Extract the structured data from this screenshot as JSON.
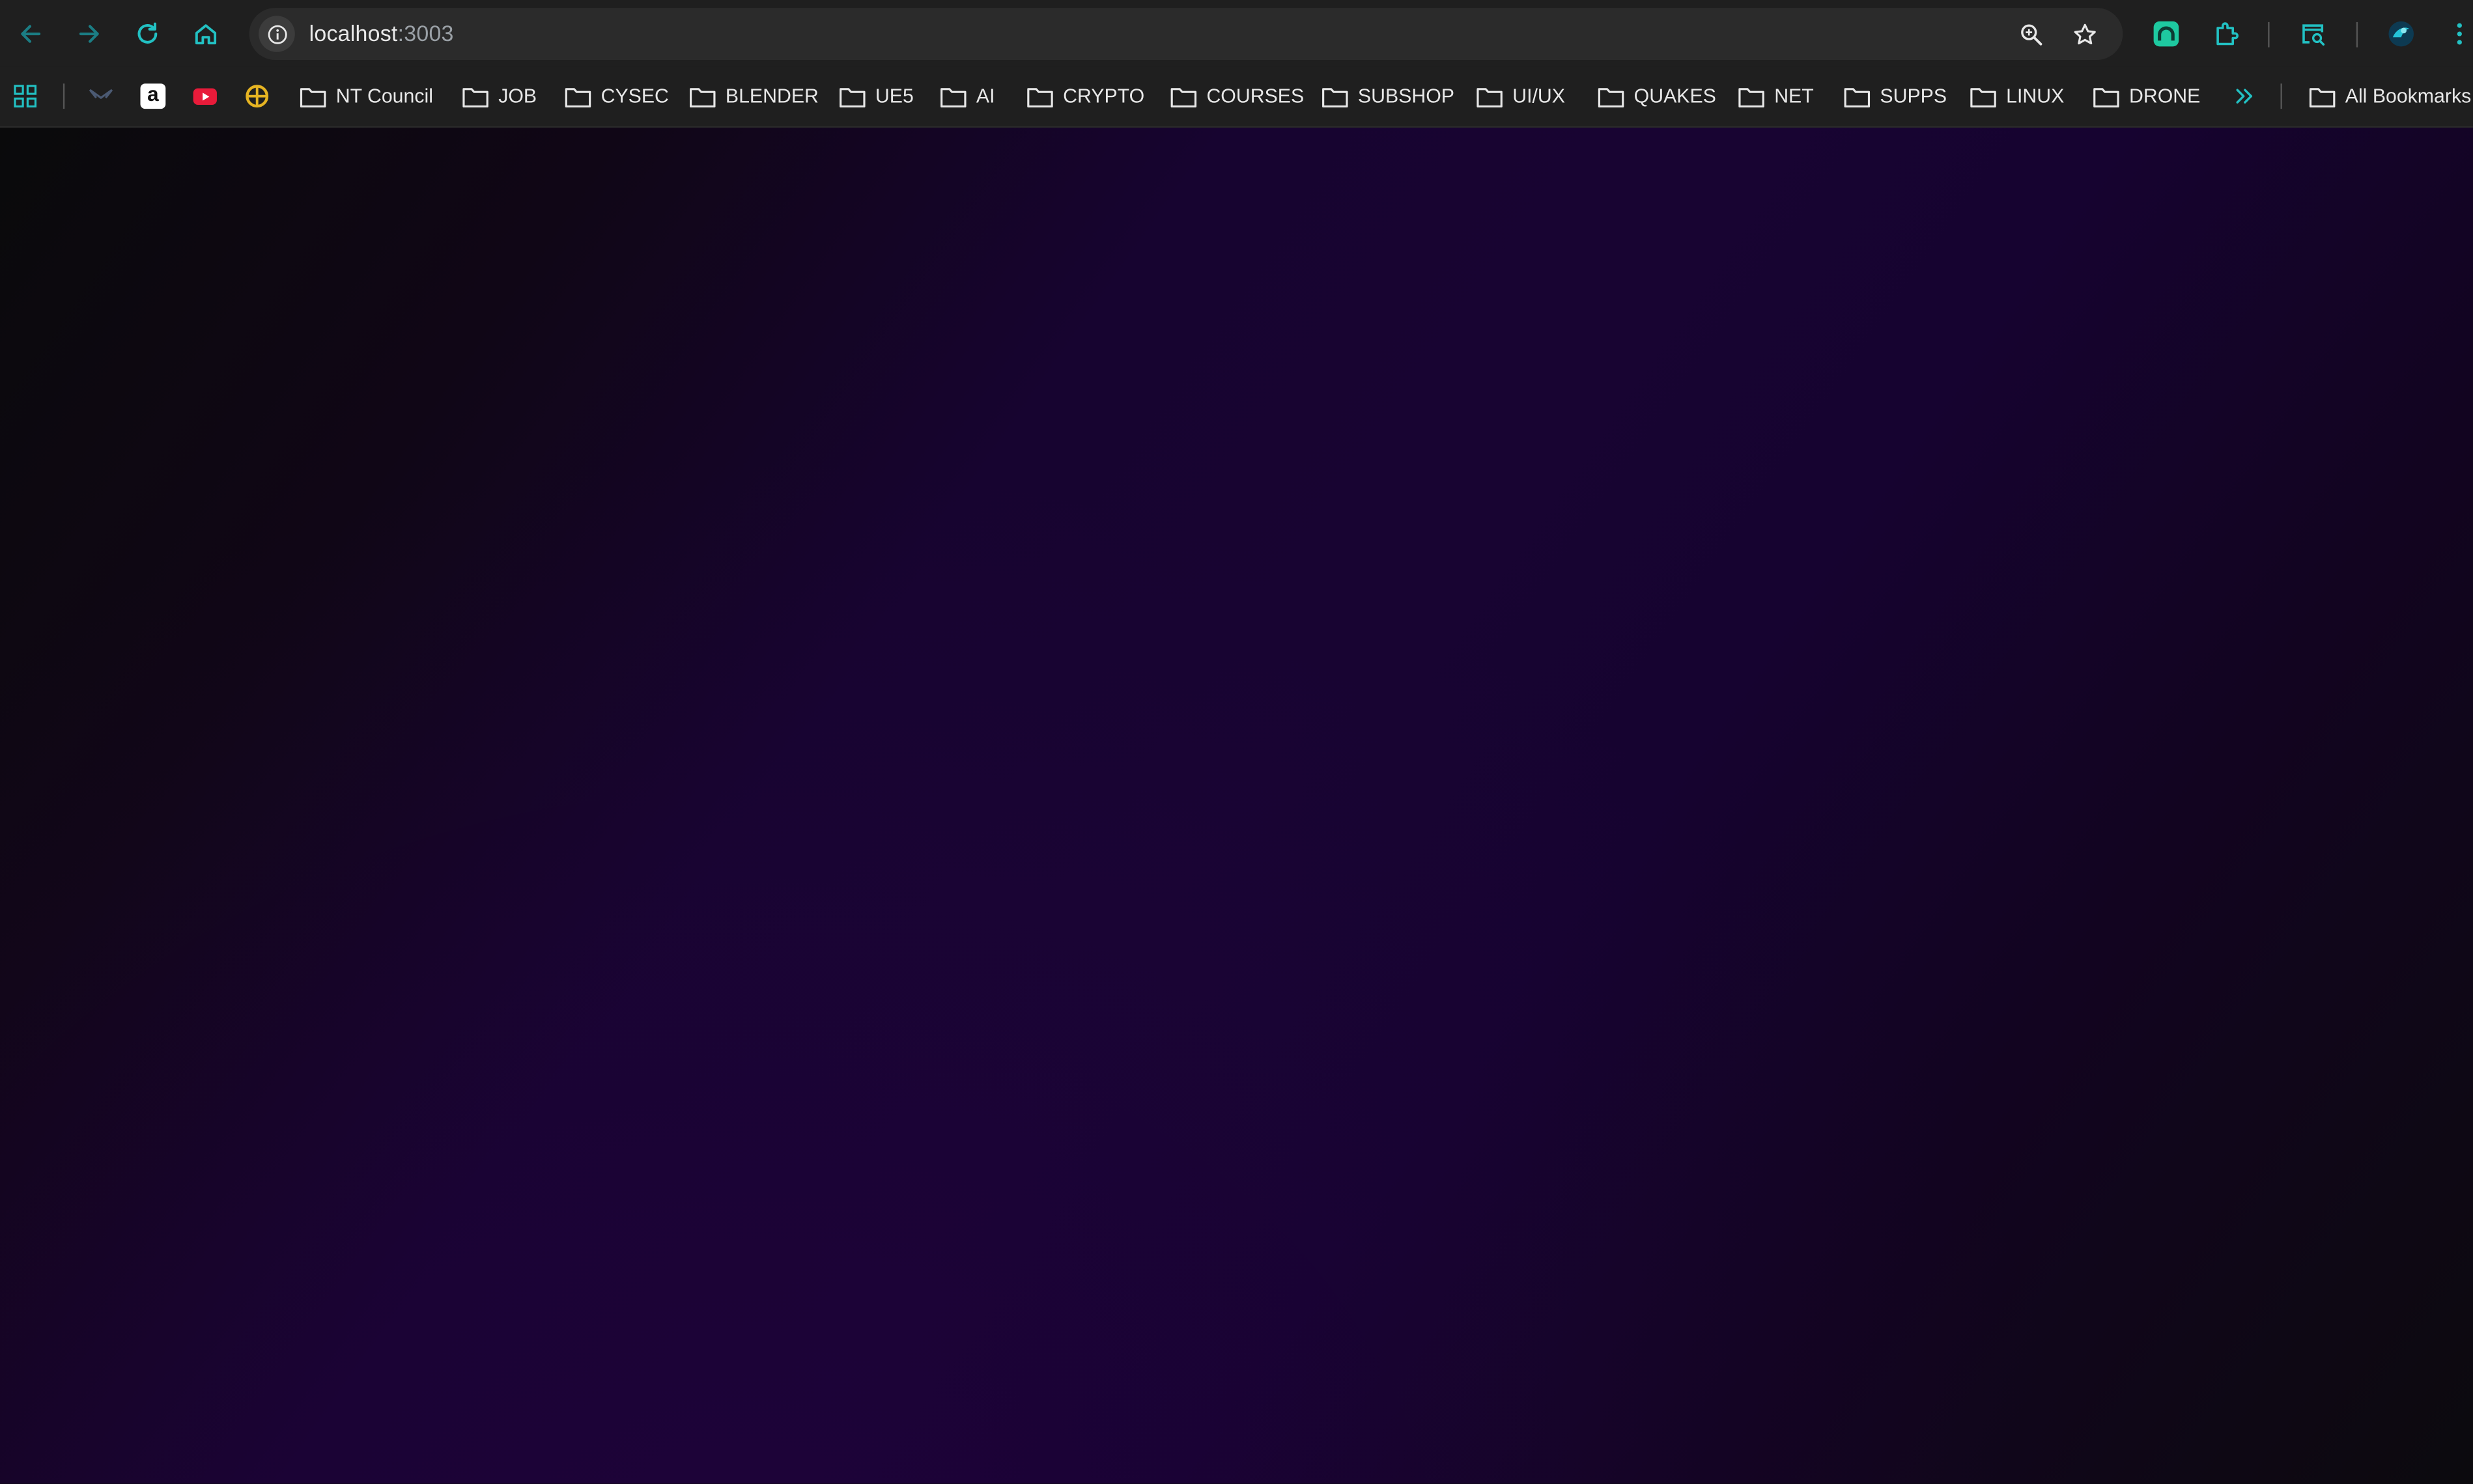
{
  "browser": {
    "url_host": "localhost",
    "url_port": ":3003",
    "accent_color": "#22c1c3"
  },
  "bookmarks": {
    "folders": [
      "NT Council",
      "JOB",
      "CYSEC",
      "BLENDER",
      "UE5",
      "AI",
      "CRYPTO",
      "COURSES",
      "SUBSHOP",
      "UI/UX",
      "QUAKES",
      "NET",
      "SUPPS",
      "LINUX",
      "DRONE"
    ],
    "all_bookmarks_label": "All Bookmarks",
    "amazon_glyph": "a"
  },
  "page": {
    "background_colors": [
      "#0a0a0b",
      "#170430",
      "#0c0a0e"
    ]
  }
}
